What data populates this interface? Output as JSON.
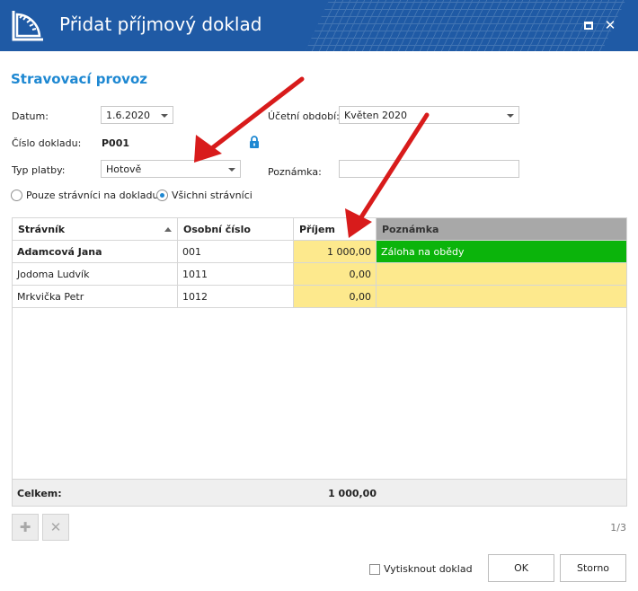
{
  "window": {
    "title": "Přidat příjmový doklad",
    "maximize_icon": "maximize-icon",
    "close_icon": "close-icon",
    "close_glyph": "✕"
  },
  "section_title": "Stravovací provoz",
  "form": {
    "date_label": "Datum:",
    "date_value": "1.6.2020",
    "period_label": "Účetní období:",
    "period_value": "Květen 2020",
    "doc_number_label": "Číslo dokladu:",
    "doc_number_value": "P001",
    "payment_type_label": "Typ platby:",
    "payment_type_value": "Hotově",
    "note_label": "Poznámka:",
    "note_value": ""
  },
  "filter": {
    "option_document_only": "Pouze strávníci na dokladu",
    "option_all": "Všichni strávníci",
    "selected": "all"
  },
  "grid": {
    "columns": [
      "Strávník",
      "Osobní číslo",
      "Příjem",
      "Poznámka"
    ],
    "rows": [
      {
        "name": "Adamcová Jana",
        "personal_number": "001",
        "income": "1 000,00",
        "note": "Záloha na obědy"
      },
      {
        "name": "Jodoma Ludvík",
        "personal_number": "1011",
        "income": "0,00",
        "note": ""
      },
      {
        "name": "Mrkvička Petr",
        "personal_number": "1012",
        "income": "0,00",
        "note": ""
      }
    ],
    "footer_label": "Celkem:",
    "footer_total": "1 000,00"
  },
  "toolbar": {
    "add_glyph": "✚",
    "delete_glyph": "✕"
  },
  "page_indicator": "1/3",
  "actions": {
    "print_label": "Vytisknout doklad",
    "ok_label": "OK",
    "cancel_label": "Storno"
  },
  "colors": {
    "titlebar": "#1f5aa5",
    "accent": "#1e88d2",
    "highlight_yellow": "#fde98d",
    "highlight_green": "#0bb40b",
    "annotation_arrow": "#d81b1b"
  }
}
